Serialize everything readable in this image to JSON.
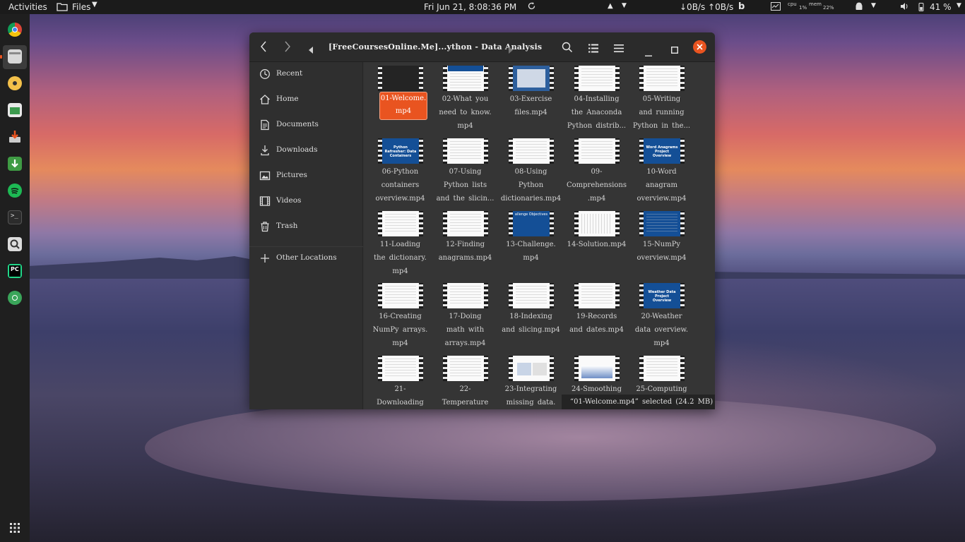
{
  "topbar": {
    "activities": "Activities",
    "app_menu": "Files",
    "clock": "Fri Jun 21,  8:08:36 PM",
    "net_speed": "↓0B/s ↑0B/s",
    "cpu_label": "cpu",
    "cpu_value": "1%",
    "mem_label": "mem",
    "mem_value": "22%",
    "battery": "41 %"
  },
  "window": {
    "path": "[FreeCoursesOnline.Me]...ython  -  Data  Analysis"
  },
  "sidebar": {
    "items": [
      {
        "label": "Recent",
        "icon": "clock-icon"
      },
      {
        "label": "Home",
        "icon": "home-icon"
      },
      {
        "label": "Documents",
        "icon": "document-icon"
      },
      {
        "label": "Downloads",
        "icon": "download-icon"
      },
      {
        "label": "Pictures",
        "icon": "picture-icon"
      },
      {
        "label": "Videos",
        "icon": "film-icon"
      },
      {
        "label": "Trash",
        "icon": "trash-icon"
      },
      {
        "label": "Other Locations",
        "icon": "plus-icon"
      }
    ]
  },
  "files": [
    {
      "l1": "01-Welcome.",
      "l2": "mp4",
      "l3": "",
      "thumb": "dark",
      "selected": true
    },
    {
      "l1": "02-What  you",
      "l2": "need  to  know.",
      "l3": "mp4",
      "thumb": "white"
    },
    {
      "l1": "03-Exercise",
      "l2": "files.mp4",
      "l3": "",
      "thumb": "blue-light"
    },
    {
      "l1": "04-Installing",
      "l2": "the  Anaconda",
      "l3": "Python  distrib...",
      "thumb": "white"
    },
    {
      "l1": "05-Writing",
      "l2": "and  running",
      "l3": "Python  in  the...",
      "thumb": "white"
    },
    {
      "l1": "06-Python",
      "l2": "containers",
      "l3": "overview.mp4",
      "thumb": "blue",
      "thumb_text": "Python Refresher: Data Containers"
    },
    {
      "l1": "07-Using",
      "l2": "Python  lists",
      "l3": "and  the  slicin...",
      "thumb": "white"
    },
    {
      "l1": "08-Using",
      "l2": "Python",
      "l3": "dictionaries.mp4",
      "thumb": "white"
    },
    {
      "l1": "09-",
      "l2": "Comprehensions",
      "l3": ".mp4",
      "thumb": "white"
    },
    {
      "l1": "10-Word",
      "l2": "anagram",
      "l3": "overview.mp4",
      "thumb": "blue",
      "thumb_text": "Word Anagrams Project Overview"
    },
    {
      "l1": "11-Loading",
      "l2": "the  dictionary.",
      "l3": "mp4",
      "thumb": "white"
    },
    {
      "l1": "12-Finding",
      "l2": "anagrams.mp4",
      "l3": "",
      "thumb": "white"
    },
    {
      "l1": "13-Challenge.",
      "l2": "mp4",
      "l3": "",
      "thumb": "blue",
      "thumb_text": "allenge Objectives"
    },
    {
      "l1": "14-Solution.mp4",
      "l2": "",
      "l3": "",
      "thumb": "white"
    },
    {
      "l1": "15-NumPy",
      "l2": "overview.mp4",
      "l3": "",
      "thumb": "blue",
      "thumb_text": ""
    },
    {
      "l1": "16-Creating",
      "l2": "NumPy  arrays.",
      "l3": "mp4",
      "thumb": "white"
    },
    {
      "l1": "17-Doing",
      "l2": "math  with",
      "l3": "arrays.mp4",
      "thumb": "white"
    },
    {
      "l1": "18-Indexing",
      "l2": "and  slicing.mp4",
      "l3": "",
      "thumb": "white"
    },
    {
      "l1": "19-Records",
      "l2": "and  dates.mp4",
      "l3": "",
      "thumb": "white"
    },
    {
      "l1": "20-Weather",
      "l2": "data  overview.",
      "l3": "mp4",
      "thumb": "blue",
      "thumb_text": "Weather Data Project Overview"
    },
    {
      "l1": "21-",
      "l2": "Downloading",
      "l3": "",
      "thumb": "white"
    },
    {
      "l1": "22-",
      "l2": "Temperature",
      "l3": "",
      "thumb": "white"
    },
    {
      "l1": "23-Integrating",
      "l2": "missing  data.",
      "l3": "",
      "thumb": "white"
    },
    {
      "l1": "24-Smoothing",
      "l2": "",
      "l3": "",
      "thumb": "white"
    },
    {
      "l1": "25-Computing",
      "l2": "",
      "l3": "",
      "thumb": "white"
    }
  ],
  "status": "“01-Welcome.mp4”  selected  (24.2  MB)",
  "colors": {
    "accent": "#e95420",
    "window_bg": "#333333",
    "sidebar_bg": "#2f2f2f"
  }
}
